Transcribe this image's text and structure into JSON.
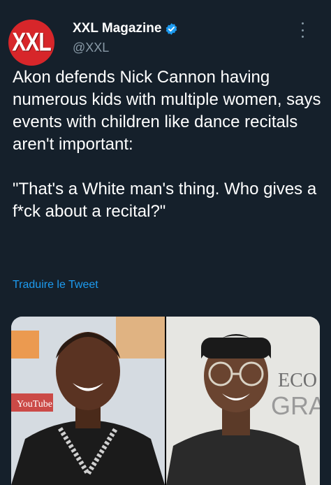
{
  "account": {
    "avatar_text": "XXL",
    "name": "XXL Magazine",
    "handle": "@XXL",
    "verified": true,
    "avatar_color": "#d7262a"
  },
  "tweet": {
    "text": "Akon defends Nick Cannon having numerous kids with multiple women, says events with children like dance recitals aren't important:\n\n\"That's a White man's thing. Who gives a f*ck about a recital?\"",
    "translate_label": "Traduire le Tweet"
  },
  "media": {
    "left_backdrop_text": "YouTube",
    "right_backdrop_text_1": "ECO",
    "right_backdrop_text_2": "GRA"
  },
  "colors": {
    "background": "#15202b",
    "link": "#1d9bf0",
    "secondary_text": "#8899a6",
    "verified": "#1d9bf0"
  },
  "icons": {
    "verified": "verified-badge-icon",
    "more": "more-options-icon"
  }
}
